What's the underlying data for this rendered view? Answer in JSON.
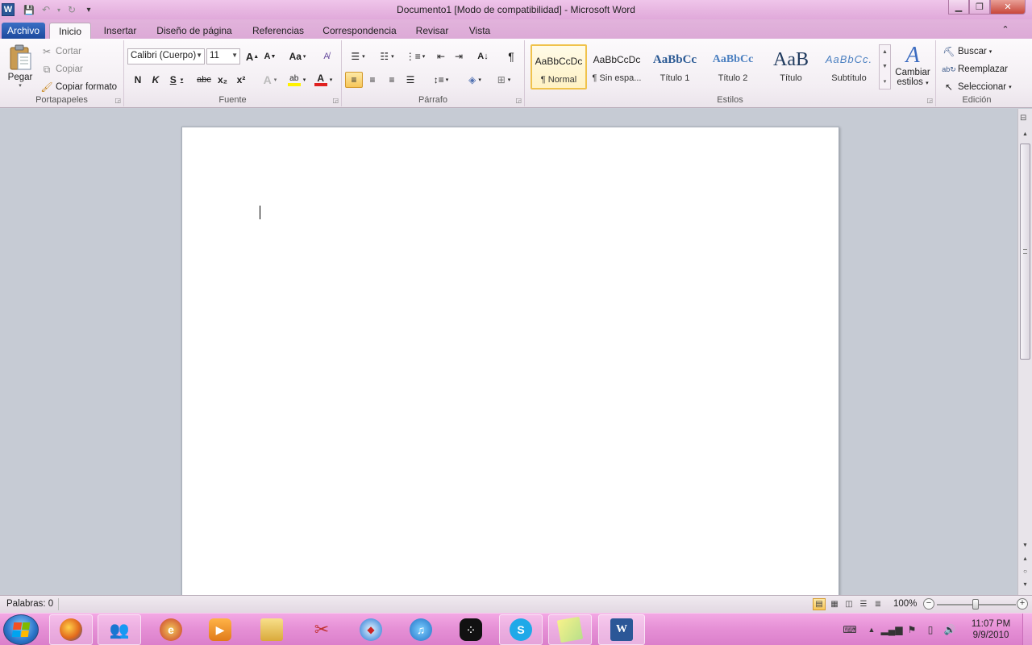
{
  "window": {
    "title": "Documento1 [Modo de compatibilidad]  -  Microsoft Word",
    "min_icon": "minimize-icon",
    "max_icon": "restore-icon",
    "close_icon": "close-icon",
    "min_glyph": "▁",
    "max_glyph": "❐",
    "close_glyph": "✕"
  },
  "qat": {
    "app_glyph": "W",
    "save_glyph": "💾",
    "undo_glyph": "↶",
    "redo_glyph": "↻",
    "custom_glyph": "▾"
  },
  "tabs": {
    "file": "Archivo",
    "items": [
      "Inicio",
      "Insertar",
      "Diseño de página",
      "Referencias",
      "Correspondencia",
      "Revisar",
      "Vista"
    ],
    "collapse_glyph": "⌃",
    "help_glyph": "?"
  },
  "clipboard": {
    "paste": "Pegar",
    "cut": "Cortar",
    "copy": "Copiar",
    "format_painter": "Copiar formato",
    "label": "Portapapeles"
  },
  "font": {
    "name": "Calibri (Cuerpo)",
    "size": "11",
    "bold": "N",
    "italic": "K",
    "underline": "S",
    "strike": "abc",
    "sub": "x₂",
    "sup": "x²",
    "grow": "A",
    "shrink": "A",
    "case": "Aa",
    "text_effects": "A",
    "highlight": "ab",
    "font_color": "A",
    "label": "Fuente"
  },
  "paragraph": {
    "label": "Párrafo",
    "pilcrow": "¶"
  },
  "styles": {
    "label": "Estilos",
    "items": [
      {
        "preview": "AaBbCcDc",
        "name": "¶ Normal"
      },
      {
        "preview": "AaBbCcDc",
        "name": "¶ Sin espa..."
      },
      {
        "preview": "AaBbCc",
        "name": "Título 1"
      },
      {
        "preview": "AaBbCc",
        "name": "Título 2"
      },
      {
        "preview": "AaB",
        "name": "Título"
      },
      {
        "preview": "AaBbCc.",
        "name": "Subtítulo"
      }
    ],
    "change_line1": "Cambiar",
    "change_line2": "estilos"
  },
  "editing": {
    "find": "Buscar",
    "replace": "Reemplazar",
    "select": "Seleccionar",
    "label": "Edición"
  },
  "status": {
    "words": "Palabras: 0",
    "zoom": "100%",
    "zoom_minus": "−",
    "zoom_plus": "+"
  },
  "taskbar": {
    "clock_time": "11:07 PM",
    "clock_date": "9/9/2010",
    "apps": [
      "firefox-icon",
      "messenger-icon",
      "ie-icon",
      "media-player-icon",
      "explorer-icon",
      "snipping-icon",
      "safari-icon",
      "itunes-icon",
      "blackberry-icon",
      "skype-icon",
      "sticky-notes-icon",
      "word-icon"
    ]
  },
  "colors": {
    "titlebar": "#e6b4e0",
    "file_tab": "#2b5797",
    "taskbar": "#e58fd5",
    "font_color_red": "#e02020",
    "highlight_yellow": "#fff200"
  }
}
